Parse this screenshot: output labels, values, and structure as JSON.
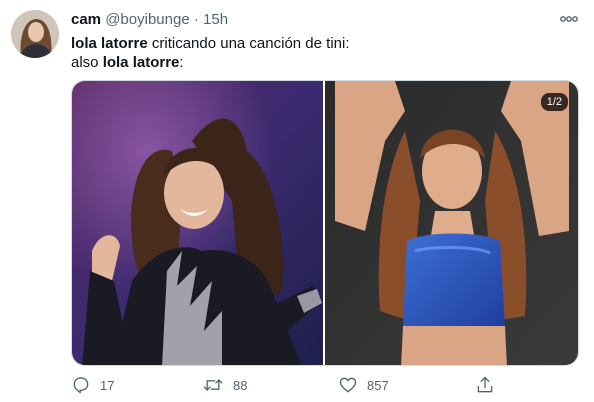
{
  "tweet": {
    "author_name": "cam",
    "handle": "@boyibunge",
    "separator": "·",
    "time": "15h",
    "line1_bold": "lola latorre",
    "line1_rest": " criticando una canción de tini:",
    "line2_prefix": "also ",
    "line2_bold": "lola latorre",
    "line2_suffix": ":"
  },
  "media": {
    "counter": "1/2",
    "photo_left": "performer-on-stage",
    "photo_right": "woman-in-blue-top"
  },
  "actions": {
    "reply_count": "17",
    "retweet_count": "88",
    "like_count": "857"
  },
  "icons": {
    "more": "more-dots-icon",
    "reply": "reply-icon",
    "retweet": "retweet-icon",
    "like": "heart-icon",
    "share": "share-icon"
  },
  "colors": {
    "secondary_text": "#536471",
    "primary_text": "#0f1419",
    "border": "#cfd9de"
  }
}
